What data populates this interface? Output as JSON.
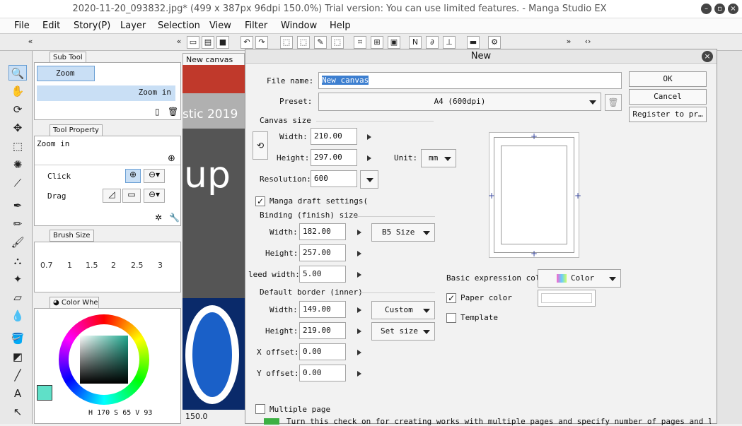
{
  "window": {
    "title": "2020-11-20_093832.jpg* (499 x 387px 96dpi 150.0%)  Trial version: You can use limited features. - Manga Studio EX"
  },
  "menu": [
    "File",
    "Edit",
    "Story(P)",
    "Layer",
    "Selection",
    "View",
    "Filter",
    "Window",
    "Help"
  ],
  "sub_tool": {
    "tab": "Sub Tool",
    "items": [
      "Zoom",
      "Zoom in"
    ]
  },
  "tool_property": {
    "tab": "Tool Property",
    "mode": "Zoom in",
    "rows": [
      {
        "label": "Click"
      },
      {
        "label": "Drag"
      }
    ]
  },
  "brush_size": {
    "tab": "Brush Size",
    "values": [
      "0.7",
      "1",
      "1.5",
      "2",
      "2.5",
      "3"
    ]
  },
  "color_wheel": {
    "tab": "Color Whe",
    "h": "170",
    "s": "65",
    "v": "93",
    "h_label": "H",
    "s_label": "S",
    "v_label": "V",
    "current_color": "#5fe0c8"
  },
  "canvas": {
    "tab": "New canvas",
    "text_line1": "stic 2019",
    "text_big": "up",
    "zoom": "150.0"
  },
  "dialog": {
    "title": "New",
    "file_name_label": "File name:",
    "file_name_value": "New canvas",
    "preset_label": "Preset:",
    "preset_value": "A4 (600dpi)",
    "canvas_size_title": "Canvas size",
    "width_label": "Width:",
    "width_value": "210.00",
    "height_label": "Height:",
    "height_value": "297.00",
    "unit_label": "Unit:",
    "unit_value": "mm",
    "resolution_label": "Resolution:",
    "resolution_value": "600",
    "manga_draft_label": "Manga draft settings(",
    "binding_title": "Binding (finish) size",
    "binding_width_value": "182.00",
    "binding_height_value": "257.00",
    "binding_size_value": "B5 Size",
    "bleed_label": "leed width:",
    "bleed_value": "5.00",
    "border_title": "Default border (inner)",
    "border_width_value": "149.00",
    "border_height_value": "219.00",
    "border_custom_value": "Custom",
    "set_size_value": "Set size",
    "x_offset_label": "X offset:",
    "x_offset_value": "0.00",
    "y_offset_label": "Y offset:",
    "y_offset_value": "0.00",
    "basic_expression_label": "Basic expression colo",
    "basic_expression_value": "Color",
    "paper_color_label": "Paper color",
    "template_label": "Template",
    "multiple_pages_label": "Multiple page",
    "hint_text": "Turn this check on for creating works with multiple pages and specify number of pages and layou",
    "ok_label": "OK",
    "cancel_label": "Cancel",
    "register_label": "Register to pr…"
  },
  "colors": {
    "accent": "#3d7fd0",
    "selection": "#c9dff5"
  }
}
